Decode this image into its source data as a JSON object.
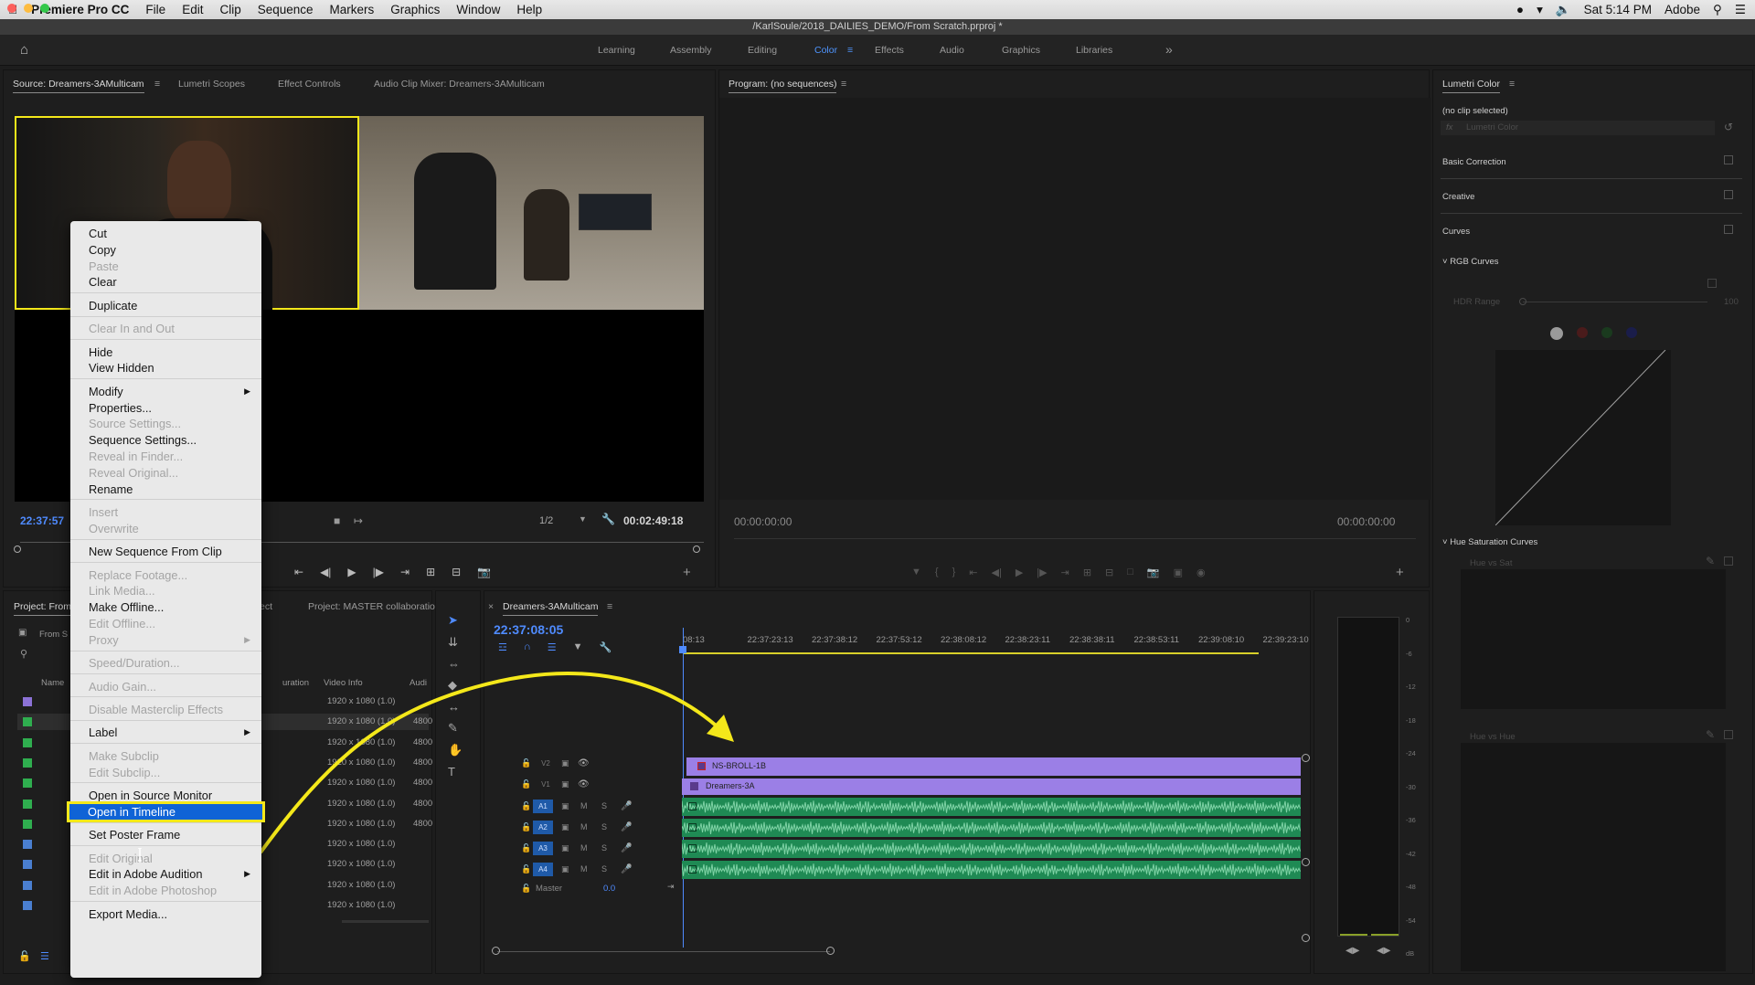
{
  "menubar": {
    "app_name": "Premiere Pro CC",
    "items": [
      "File",
      "Edit",
      "Clip",
      "Sequence",
      "Markers",
      "Graphics",
      "Window",
      "Help"
    ],
    "clock": "Sat 5:14 PM",
    "user": "Adobe"
  },
  "title": "/KarlSoule/2018_DAILIES_DEMO/From Scratch.prproj *",
  "workspaces": [
    "Learning",
    "Assembly",
    "Editing",
    "Color",
    "Effects",
    "Audio",
    "Graphics",
    "Libraries"
  ],
  "workspaces_more": "»",
  "source_panel": {
    "tabs": [
      "Source: Dreamers-3AMulticam",
      "Lumetri Scopes",
      "Effect Controls",
      "Audio Clip Mixer: Dreamers-3AMulticam"
    ],
    "timecode_in": "22:37:57",
    "zoom": "1/2",
    "duration": "00:02:49:18"
  },
  "program_panel": {
    "title": "Program: (no sequences)",
    "tc_left": "00:00:00:00",
    "tc_right": "00:00:00:00"
  },
  "lumetri": {
    "title": "Lumetri Color",
    "no_clip": "(no clip selected)",
    "fx_label": "fx",
    "effect_name": "Lumetri Color",
    "sections": [
      "Basic Correction",
      "Creative",
      "Curves"
    ],
    "rgb_curves": "RGB Curves",
    "hdr_range": "HDR Range",
    "hdr_value": "100",
    "hue_sat_curves": "Hue Saturation Curves",
    "hue_vs_sat": "Hue vs Sat",
    "hue_vs_hue": "Hue vs Hue"
  },
  "project_panel": {
    "tab1": "Project: From",
    "tab2": "ect",
    "tab3": "Project: MASTER collaboratio",
    "bin": "From S",
    "col_name": "Name",
    "col_duration": "uration",
    "col_video_info": "Video Info",
    "col_audio": "Audi",
    "rows": [
      {
        "color": "#8c72d6",
        "video": "1920 x 1080 (1.0)",
        "audio": ""
      },
      {
        "color": "#2fae4f",
        "video": "1920 x 1080 (1.0)",
        "audio": "4800"
      },
      {
        "color": "#2fae4f",
        "video": "1920 x 1080 (1.0)",
        "audio": "4800"
      },
      {
        "color": "#2fae4f",
        "video": "1920 x 1080 (1.0)",
        "audio": "4800"
      },
      {
        "color": "#2fae4f",
        "video": "1920 x 1080 (1.0)",
        "audio": "4800"
      },
      {
        "color": "#2fae4f",
        "video": "1920 x 1080 (1.0)",
        "audio": "4800"
      },
      {
        "color": "#2fae4f",
        "video": "1920 x 1080 (1.0)",
        "audio": "4800"
      },
      {
        "color": "#4a7fd0",
        "video": "1920 x 1080 (1.0)",
        "audio": ""
      },
      {
        "color": "#4a7fd0",
        "video": "1920 x 1080 (1.0)",
        "audio": ""
      },
      {
        "color": "#4a7fd0",
        "video": "1920 x 1080 (1.0)",
        "audio": ""
      },
      {
        "color": "#4a7fd0",
        "video": "1920 x 1080 (1.0)",
        "audio": ""
      }
    ]
  },
  "timeline": {
    "tab": "Dreamers-3AMulticam",
    "timecode": "22:37:08:05",
    "ruler": [
      "08:13",
      "22:37:23:13",
      "22:37:38:12",
      "22:37:53:12",
      "22:38:08:12",
      "22:38:23:11",
      "22:38:38:11",
      "22:38:53:11",
      "22:39:08:10",
      "22:39:23:10"
    ],
    "tracks": [
      "V2",
      "V1",
      "A1",
      "A2",
      "A3",
      "A4"
    ],
    "master_label": "Master",
    "master_value": "0.0",
    "clip_v2": "NS-BROLL-1B",
    "clip_v1": "Dreamers-3A"
  },
  "meter_scale": [
    "0",
    "-6",
    "-12",
    "-18",
    "-24",
    "-30",
    "-36",
    "-42",
    "-48",
    "-54",
    "dB"
  ],
  "context_menu": {
    "items": [
      {
        "label": "Cut",
        "enabled": true
      },
      {
        "label": "Copy",
        "enabled": true
      },
      {
        "label": "Paste",
        "enabled": false
      },
      {
        "label": "Clear",
        "enabled": true
      },
      {
        "sep": true
      },
      {
        "label": "Duplicate",
        "enabled": true
      },
      {
        "sep": true
      },
      {
        "label": "Clear In and Out",
        "enabled": false
      },
      {
        "sep": true
      },
      {
        "label": "Hide",
        "enabled": true
      },
      {
        "label": "View Hidden",
        "enabled": true
      },
      {
        "sep": true
      },
      {
        "label": "Modify",
        "enabled": true,
        "submenu": true
      },
      {
        "label": "Properties...",
        "enabled": true
      },
      {
        "label": "Source Settings...",
        "enabled": false
      },
      {
        "label": "Sequence Settings...",
        "enabled": true
      },
      {
        "label": "Reveal in Finder...",
        "enabled": false
      },
      {
        "label": "Reveal Original...",
        "enabled": false
      },
      {
        "label": "Rename",
        "enabled": true
      },
      {
        "sep": true
      },
      {
        "label": "Insert",
        "enabled": false
      },
      {
        "label": "Overwrite",
        "enabled": false
      },
      {
        "sep": true
      },
      {
        "label": "New Sequence From Clip",
        "enabled": true
      },
      {
        "sep": true
      },
      {
        "label": "Replace Footage...",
        "enabled": false
      },
      {
        "label": "Link Media...",
        "enabled": false
      },
      {
        "label": "Make Offline...",
        "enabled": true
      },
      {
        "label": "Edit Offline...",
        "enabled": false
      },
      {
        "label": "Proxy",
        "enabled": false,
        "submenu": true
      },
      {
        "sep": true
      },
      {
        "label": "Speed/Duration...",
        "enabled": false
      },
      {
        "sep": true
      },
      {
        "label": "Audio Gain...",
        "enabled": false
      },
      {
        "sep": true
      },
      {
        "label": "Disable Masterclip Effects",
        "enabled": false
      },
      {
        "sep": true
      },
      {
        "label": "Label",
        "enabled": true,
        "submenu": true
      },
      {
        "sep": true
      },
      {
        "label": "Make Subclip",
        "enabled": false
      },
      {
        "label": "Edit Subclip...",
        "enabled": false
      },
      {
        "sep": true
      },
      {
        "label": "Open in Source Monitor",
        "enabled": true
      },
      {
        "label": "Open in Timeline",
        "enabled": true,
        "highlight": true
      },
      {
        "sep": true
      },
      {
        "label": "Set Poster Frame",
        "enabled": true
      },
      {
        "sep": true
      },
      {
        "label": "Edit Original",
        "enabled": false
      },
      {
        "label": "Edit in Adobe Audition",
        "enabled": true,
        "submenu": true
      },
      {
        "label": "Edit in Adobe Photoshop",
        "enabled": false
      },
      {
        "sep": true
      },
      {
        "label": "Export Media...",
        "enabled": true
      }
    ]
  },
  "colors": {
    "accent_blue": "#4f8bff",
    "highlight_yellow": "#f4e81a",
    "clip_purple": "#9b7fe6",
    "audio_green": "#1f8a54",
    "menu_highlight": "#0f63d6"
  }
}
